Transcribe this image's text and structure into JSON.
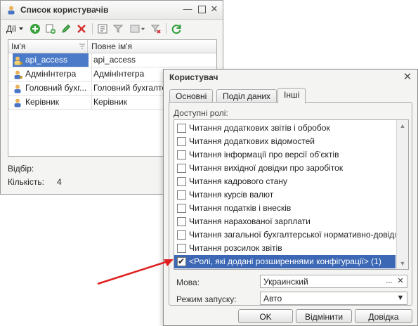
{
  "users_window": {
    "title": "Список користувачів",
    "toolbar": {
      "actions_label": "Дії"
    },
    "columns": [
      "Ім'я",
      "Повне ім'я"
    ],
    "rows": [
      {
        "name": "api_access",
        "full_name": "api_access"
      },
      {
        "name": "АдмінІнтегра",
        "full_name": "АдмінІнтегра"
      },
      {
        "name": "Головний бухг...",
        "full_name": "Головний бухгалтер"
      },
      {
        "name": "Керівник",
        "full_name": "Керівник"
      }
    ],
    "filter_label": "Відбір:",
    "count_label": "Кількість:",
    "count_value": "4"
  },
  "user_dialog": {
    "title": "Користувач",
    "tabs": [
      "Основні",
      "Поділ даних",
      "Інші"
    ],
    "active_tab": "Інші",
    "roles_label": "Доступні ролі:",
    "roles": [
      {
        "label": "Читання додаткових звітів і обробок",
        "checked": false
      },
      {
        "label": "Читання додаткових відомостей",
        "checked": false
      },
      {
        "label": "Читання інформації про версії об'єктів",
        "checked": false
      },
      {
        "label": "Читання вихідної довідки про заробіток",
        "checked": false
      },
      {
        "label": "Читання кадрового стану",
        "checked": false
      },
      {
        "label": "Читання курсів валют",
        "checked": false
      },
      {
        "label": "Читання податків і внесків",
        "checked": false
      },
      {
        "label": "Читання нарахованої зарплати",
        "checked": false
      },
      {
        "label": "Читання загальної бухгалтерської нормативно-довідко...",
        "checked": false
      },
      {
        "label": "Читання розсилок звітів",
        "checked": false
      },
      {
        "label": "<Ролі, які додані розширеннями конфігурації> (1)",
        "checked": true
      }
    ],
    "language_label": "Мова:",
    "language_value": "Украинский",
    "launch_mode_label": "Режим запуску:",
    "launch_mode_value": "Авто",
    "buttons": {
      "ok": "OK",
      "cancel": "Відмінити",
      "help": "Довідка"
    }
  },
  "colors": {
    "selection": "#3b67b4",
    "arrow": "#e02020"
  }
}
